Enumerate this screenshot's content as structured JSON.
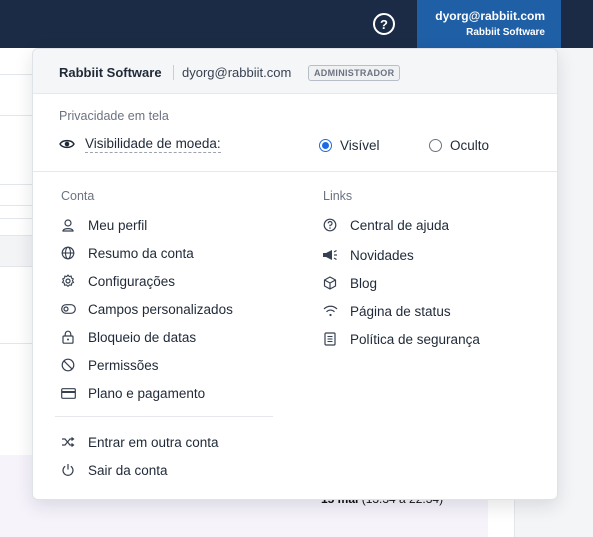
{
  "topbar": {
    "help_icon": "question-circle-icon",
    "account": {
      "email": "dyorg@rabbiit.com",
      "org": "Rabbiit Software"
    }
  },
  "background": {
    "fragment_bold": "15 mai",
    "fragment_rest": " (13:34 a 22:34)"
  },
  "dropdown": {
    "header": {
      "org": "Rabbiit Software",
      "email": "dyorg@rabbiit.com",
      "role_badge": "ADMINISTRADOR"
    },
    "privacy": {
      "section_label": "Privacidade em tela",
      "visibility_label": "Visibilidade de moeda:",
      "options": [
        {
          "label": "Visível",
          "selected": true
        },
        {
          "label": "Oculto",
          "selected": false
        }
      ]
    },
    "account_section": {
      "title": "Conta",
      "items": [
        {
          "label": "Meu perfil",
          "icon": "user-icon"
        },
        {
          "label": "Resumo da conta",
          "icon": "globe-icon"
        },
        {
          "label": "Configurações",
          "icon": "gear-icon"
        },
        {
          "label": "Campos personalizados",
          "icon": "toggle-icon"
        },
        {
          "label": "Bloqueio de datas",
          "icon": "lock-icon"
        },
        {
          "label": "Permissões",
          "icon": "ban-icon"
        },
        {
          "label": "Plano e pagamento",
          "icon": "credit-card-icon"
        }
      ],
      "secondary_items": [
        {
          "label": "Entrar em outra conta",
          "icon": "shuffle-icon"
        },
        {
          "label": "Sair da conta",
          "icon": "power-icon"
        }
      ]
    },
    "links_section": {
      "title": "Links",
      "items": [
        {
          "label": "Central de ajuda",
          "icon": "question-circle-icon"
        },
        {
          "label": "Novidades",
          "icon": "megaphone-icon"
        },
        {
          "label": "Blog",
          "icon": "cube-icon"
        },
        {
          "label": "Página de status",
          "icon": "wifi-icon"
        },
        {
          "label": "Política de segurança",
          "icon": "document-icon"
        }
      ]
    }
  },
  "colors": {
    "topbar": "#1c2b45",
    "account_button": "#1f5fa6",
    "radio_accent": "#1f6ae0"
  }
}
